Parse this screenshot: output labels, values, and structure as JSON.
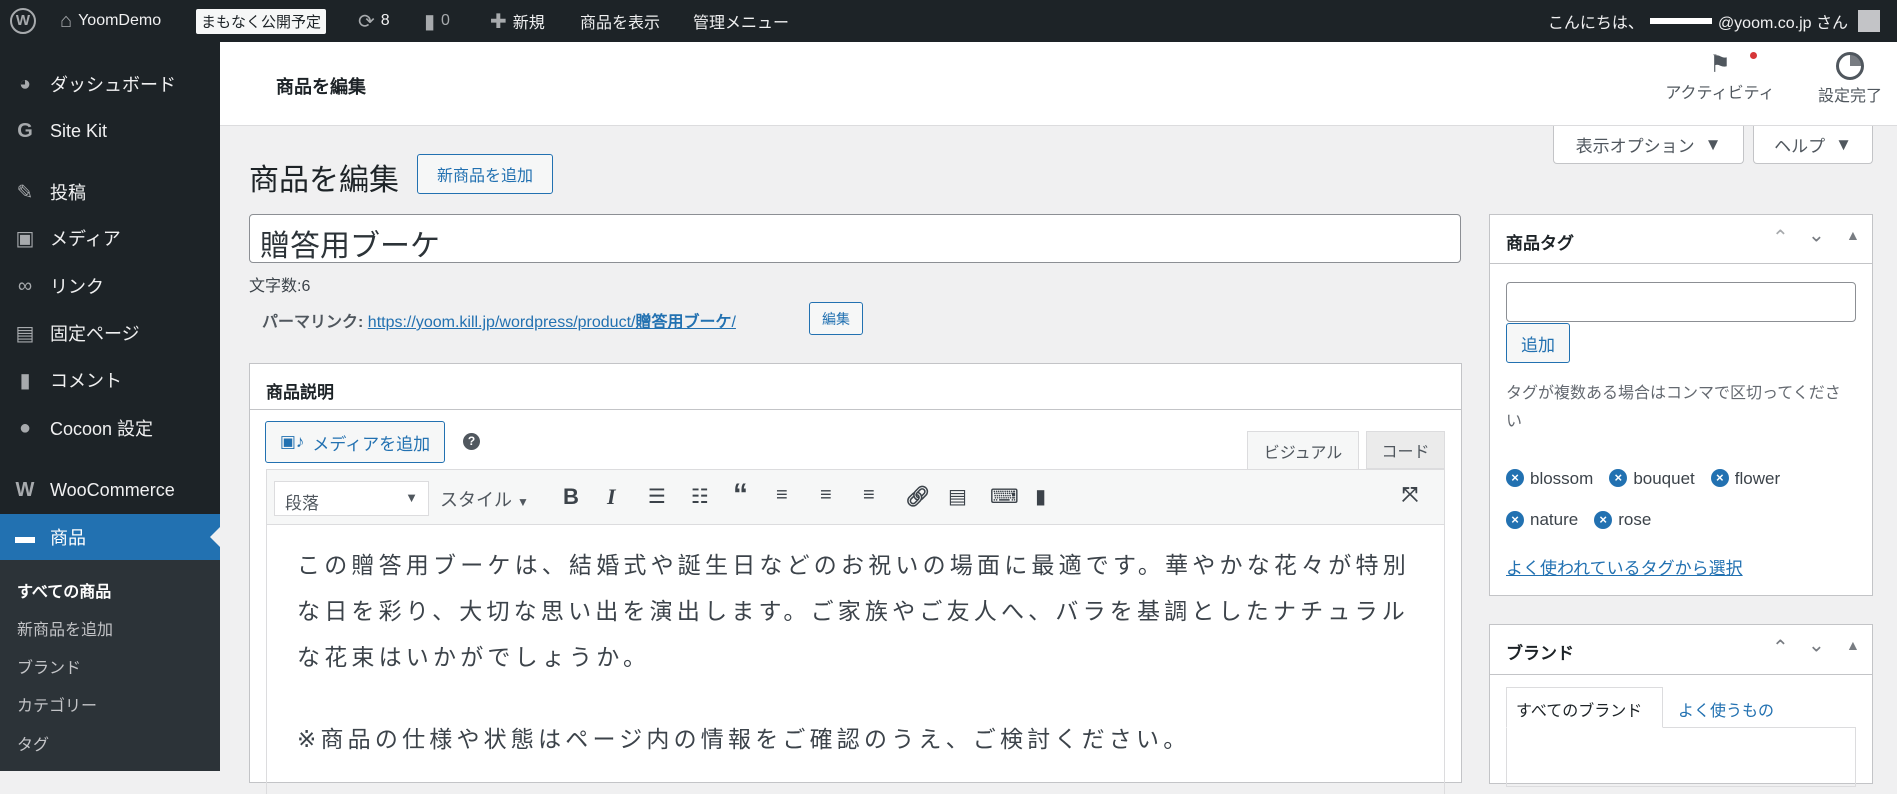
{
  "adminbar": {
    "site": "YoomDemo",
    "badge": "まもなく公開予定",
    "updates": "8",
    "comments": "0",
    "new": "新規",
    "view": "商品を表示",
    "admin_menu": "管理メニュー",
    "greeting": "こんにちは、",
    "email": "@yoom.co.jp さん"
  },
  "sidebar": {
    "items": [
      {
        "label": "ダッシュボード",
        "icon": "dashboard-icon"
      },
      {
        "label": "Site Kit",
        "icon": "google-icon"
      },
      {
        "label": "投稿",
        "icon": "pin-icon"
      },
      {
        "label": "メディア",
        "icon": "media-icon"
      },
      {
        "label": "リンク",
        "icon": "link-icon"
      },
      {
        "label": "固定ページ",
        "icon": "page-icon"
      },
      {
        "label": "コメント",
        "icon": "comment-icon"
      },
      {
        "label": "Cocoon 設定",
        "icon": "cocoon-icon"
      },
      {
        "label": "WooCommerce",
        "icon": "woo-icon"
      },
      {
        "label": "商品",
        "icon": "archive-icon"
      }
    ],
    "submenu": [
      "すべての商品",
      "新商品を追加",
      "ブランド",
      "カテゴリー",
      "タグ"
    ]
  },
  "header": {
    "title": "商品を編集",
    "activity": "アクティビティ",
    "setup": "設定完了",
    "screen_options": "表示オプション",
    "help": "ヘルプ"
  },
  "page": {
    "heading": "商品を編集",
    "add_new": "新商品を追加",
    "title_value": "贈答用ブーケ",
    "char_count": "文字数:6",
    "permalink_label": "パーマリンク:",
    "permalink_base": "https://yoom.kill.jp/wordpress/product/",
    "permalink_slug": "贈答用ブーケ",
    "permalink_end": "/",
    "edit": "編集"
  },
  "editor": {
    "box_title": "商品説明",
    "add_media": "メディアを追加",
    "tab_visual": "ビジュアル",
    "tab_code": "コード",
    "format": "段落",
    "style": "スタイル",
    "paragraphs": [
      "この贈答用ブーケは、結婚式や誕生日などのお祝いの場面に最適です。華やかな花々が特別な日を彩り、大切な思い出を演出します。ご家族やご友人へ、バラを基調としたナチュラルな花束はいかがでしょうか。",
      "※商品の仕様や状態はページ内の情報をご確認のうえ、ご検討ください。"
    ]
  },
  "tags_box": {
    "title": "商品タグ",
    "input": "",
    "add": "追加",
    "help": "タグが複数ある場合はコンマで区切ってください",
    "tags": [
      "blossom",
      "bouquet",
      "flower",
      "nature",
      "rose"
    ],
    "choose": "よく使われているタグから選択"
  },
  "brand_box": {
    "title": "ブランド",
    "tab_all": "すべてのブランド",
    "tab_popular": "よく使うもの"
  }
}
